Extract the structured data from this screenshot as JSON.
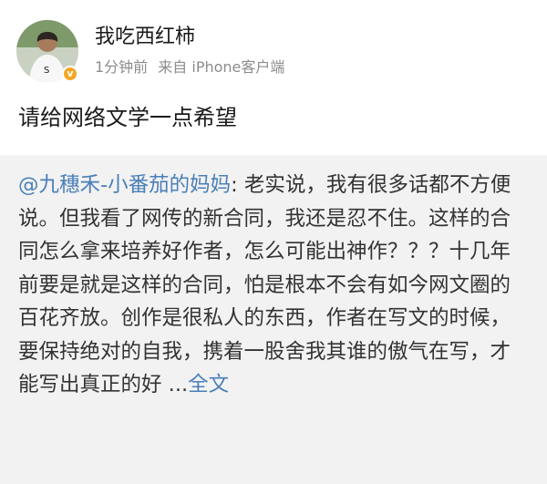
{
  "post": {
    "user": {
      "name": "我吃西红柿",
      "avatar_icon": "user-avatar",
      "verified_icon": "verified-badge-icon",
      "verified_color": "#f5a623"
    },
    "meta": {
      "time": "1分钟前",
      "source": "来自 iPhone客户端"
    },
    "content": "请给网络文学一点希望",
    "repost": {
      "mention": "@九穗禾-小番茄的妈妈",
      "text": ": 老实说，我有很多话都不方便说。但我看了网传的新合同，我还是忍不住。这样的合同怎么拿来培养好作者，怎么可能出神作？？？十几年前要是就是这样的合同，怕是根本不会有如今网文圈的百花齐放。创作是很私人的东西，作者在写文的时候，要保持绝对的自我，携着一股舍我其谁的傲气在写，才能写出真正的好",
      "ellipsis": " ...",
      "full_text_link": "全文"
    }
  },
  "colors": {
    "link": "#4a7fb8",
    "meta": "#8c8c8c",
    "repost_bg": "#f2f2f2"
  }
}
